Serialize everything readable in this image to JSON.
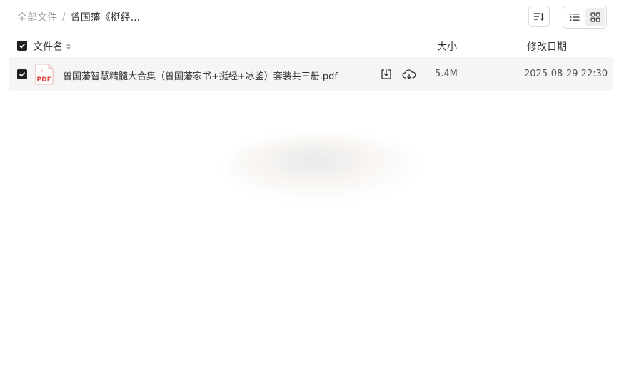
{
  "breadcrumb": {
    "root": "全部文件",
    "separator": "/",
    "current": "曾国藩《挺经..."
  },
  "toolbar": {
    "sort_icon": "sort-descending-icon",
    "view_list_icon": "list-view-icon",
    "view_grid_icon": "grid-view-icon"
  },
  "table": {
    "headers": {
      "name": "文件名",
      "size": "大小",
      "date": "修改日期"
    },
    "rows": [
      {
        "icon": "pdf-file-icon",
        "name": "曾国藩智慧精髓大合集（曾国藩家书+挺经+冰鉴）套装共三册.pdf",
        "size": "5.4M",
        "date": "2025-08-29 22:30"
      }
    ]
  },
  "colors": {
    "accent_dark": "#1f1f1f",
    "pdf_red": "#e0443c",
    "row_bg": "#f5f5f5"
  }
}
